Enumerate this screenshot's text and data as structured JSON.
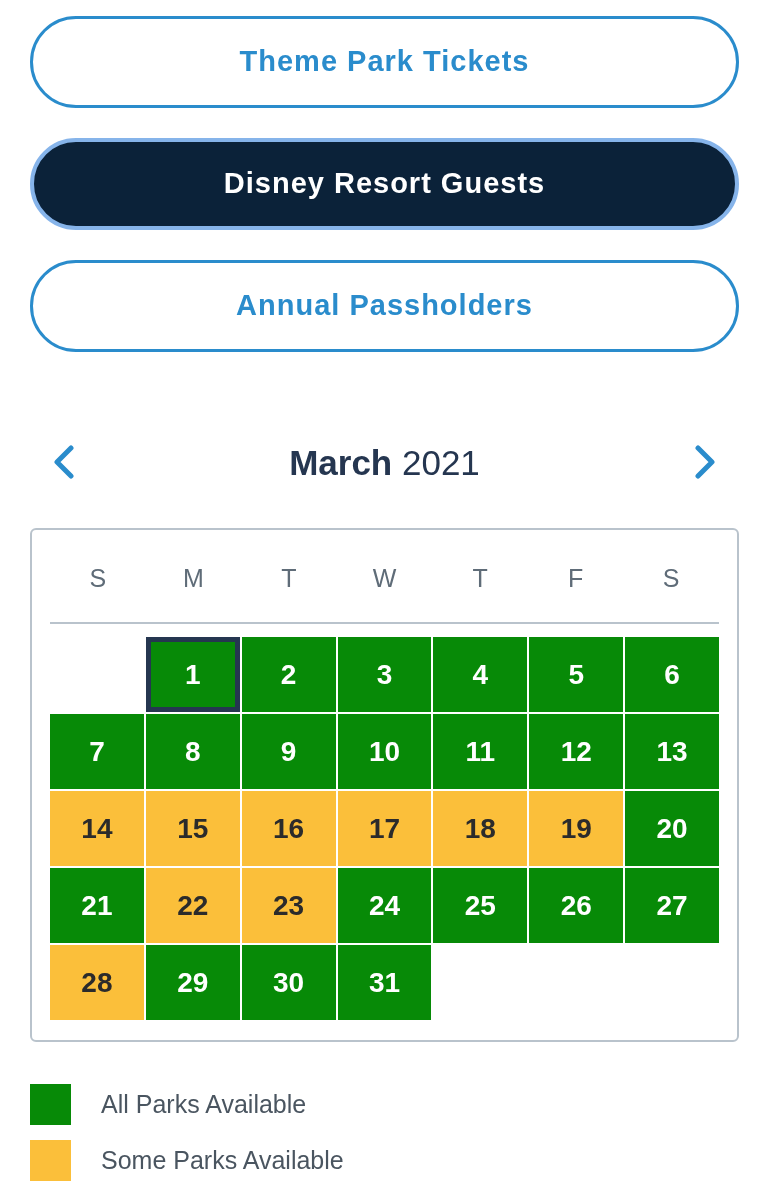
{
  "tabs": [
    {
      "label": "Theme Park Tickets",
      "selected": false
    },
    {
      "label": "Disney Resort Guests",
      "selected": true
    },
    {
      "label": "Annual Passholders",
      "selected": false
    }
  ],
  "calendar": {
    "title": "**March** 2021",
    "weekdays": [
      "S",
      "M",
      "T",
      "W",
      "T",
      "F",
      "S"
    ],
    "weeks": [
      [
        {
          "kind": "empty"
        },
        {
          "kind": "day",
          "label": "1",
          "color": "#078a07",
          "selected": true
        },
        {
          "kind": "day",
          "label": "2",
          "color": "#078a07",
          "selected": false
        },
        {
          "kind": "day",
          "label": "3",
          "color": "#078a07",
          "selected": false
        },
        {
          "kind": "day",
          "label": "4",
          "color": "#078a07",
          "selected": false
        },
        {
          "kind": "day",
          "label": "5",
          "color": "#078a07",
          "selected": false
        },
        {
          "kind": "day",
          "label": "6",
          "color": "#078a07",
          "selected": false
        }
      ],
      [
        {
          "kind": "day",
          "label": "7",
          "color": "#078a07",
          "selected": false
        },
        {
          "kind": "day",
          "label": "8",
          "color": "#078a07",
          "selected": false
        },
        {
          "kind": "day",
          "label": "9",
          "color": "#078a07",
          "selected": false
        },
        {
          "kind": "day",
          "label": "10",
          "color": "#078a07",
          "selected": false
        },
        {
          "kind": "day",
          "label": "11",
          "color": "#078a07",
          "selected": false
        },
        {
          "kind": "day",
          "label": "12",
          "color": "#078a07",
          "selected": false
        },
        {
          "kind": "day",
          "label": "13",
          "color": "#078a07",
          "selected": false
        }
      ],
      [
        {
          "kind": "day",
          "label": "14",
          "color": "#fbbf3a",
          "selected": false
        },
        {
          "kind": "day",
          "label": "15",
          "color": "#fbbf3a",
          "selected": false
        },
        {
          "kind": "day",
          "label": "16",
          "color": "#fbbf3a",
          "selected": false
        },
        {
          "kind": "day",
          "label": "17",
          "color": "#fbbf3a",
          "selected": false
        },
        {
          "kind": "day",
          "label": "18",
          "color": "#fbbf3a",
          "selected": false
        },
        {
          "kind": "day",
          "label": "19",
          "color": "#fbbf3a",
          "selected": false
        },
        {
          "kind": "day",
          "label": "20",
          "color": "#078a07",
          "selected": false
        }
      ],
      [
        {
          "kind": "day",
          "label": "21",
          "color": "#078a07",
          "selected": false
        },
        {
          "kind": "day",
          "label": "22",
          "color": "#fbbf3a",
          "selected": false
        },
        {
          "kind": "day",
          "label": "23",
          "color": "#fbbf3a",
          "selected": false
        },
        {
          "kind": "day",
          "label": "24",
          "color": "#078a07",
          "selected": false
        },
        {
          "kind": "day",
          "label": "25",
          "color": "#078a07",
          "selected": false
        },
        {
          "kind": "day",
          "label": "26",
          "color": "#078a07",
          "selected": false
        },
        {
          "kind": "day",
          "label": "27",
          "color": "#078a07",
          "selected": false
        }
      ],
      [
        {
          "kind": "day",
          "label": "28",
          "color": "#fbbf3a",
          "selected": false
        },
        {
          "kind": "day",
          "label": "29",
          "color": "#078a07",
          "selected": false
        },
        {
          "kind": "day",
          "label": "30",
          "color": "#078a07",
          "selected": false
        },
        {
          "kind": "day",
          "label": "31",
          "color": "#078a07",
          "selected": false
        }
      ]
    ]
  },
  "legend": [
    {
      "label": "All Parks Available",
      "color": "#078a07"
    },
    {
      "label": "Some Parks Available",
      "color": "#fbbf3a"
    }
  ]
}
